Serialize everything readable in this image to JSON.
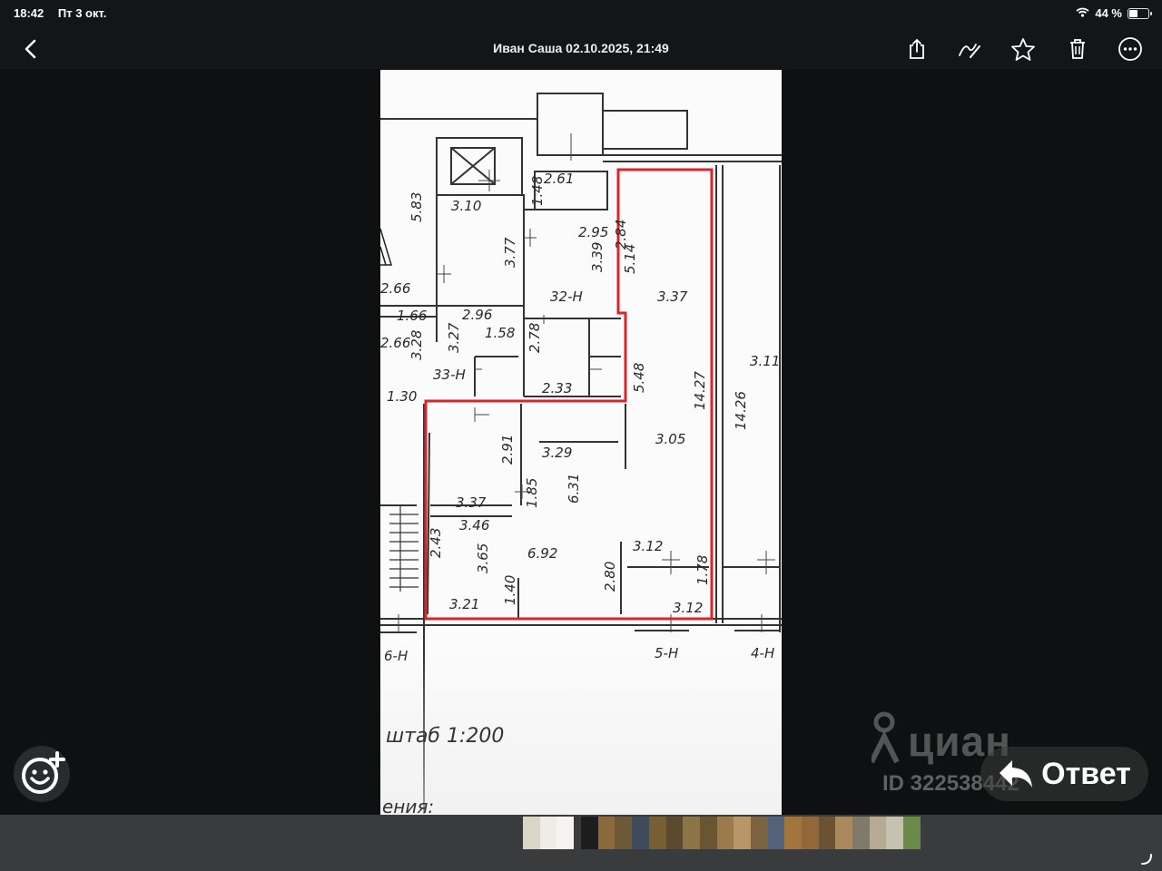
{
  "status_bar": {
    "time": "18:42",
    "date": "Пт 3 окт.",
    "battery": "44 %",
    "battery_level": 0.44,
    "icons": [
      "wifi-icon",
      "battery-icon"
    ]
  },
  "nav": {
    "title": "Иван Саша 02.10.2025, 21:49",
    "icons": [
      "back-chevron-icon",
      "share-icon",
      "markup-pen-icon",
      "star-icon",
      "trash-icon",
      "more-ellipsis-icon"
    ]
  },
  "photo": {
    "labels": [
      "2.61",
      "1.48",
      "3.10",
      "5.83",
      "2.95",
      "2.84",
      "3.77",
      "3.39",
      "5.14",
      "3.37",
      "2.66",
      "32-H",
      "1.66",
      "2.96",
      "2.66",
      "1.58",
      "3.27",
      "3.28",
      "2.78",
      "33-H",
      "3.11",
      "2.33",
      "5.48",
      "1.30",
      "14.27",
      "14.26",
      "3.05",
      "2.91",
      "3.29",
      "3.37",
      "1.85",
      "6.31",
      "3.46",
      "2.43",
      "3.65",
      "6.92",
      "3.12",
      "2.80",
      "1.78",
      "3.21",
      "1.40",
      "3.12",
      "6-H",
      "5-H",
      "4-H"
    ],
    "scale": "штаб 1:200",
    "caption_partial": "ения:",
    "highlight_color": "#d9262b"
  },
  "watermark": {
    "brand": "циан",
    "id": "ID 322538442"
  },
  "reply": {
    "label": "Ответ"
  },
  "icons": {
    "emoji_add": "emoji-add-icon",
    "reply": "reply-arrow-icon"
  },
  "thumbnails": [
    {
      "color": "#d9d6c8"
    },
    {
      "color": "#efece8"
    },
    {
      "color": "#f5f2f0"
    },
    {
      "color": "#1d1d1d"
    },
    {
      "color": "#8a6a3a"
    },
    {
      "color": "#6d5838"
    },
    {
      "color": "#3f4a5a"
    },
    {
      "color": "#7a5e33"
    },
    {
      "color": "#5c4a2e"
    },
    {
      "color": "#8d7447"
    },
    {
      "color": "#6a5533"
    },
    {
      "color": "#9a7b4e"
    },
    {
      "color": "#b89668"
    },
    {
      "color": "#7b6240"
    },
    {
      "color": "#53617a"
    },
    {
      "color": "#a3753e"
    },
    {
      "color": "#92683a"
    },
    {
      "color": "#6b5233"
    },
    {
      "color": "#aa8a5c"
    },
    {
      "color": "#807a6a"
    },
    {
      "color": "#b5ab92"
    },
    {
      "color": "#c7c1b2"
    },
    {
      "color": "#6a8a4a"
    }
  ]
}
